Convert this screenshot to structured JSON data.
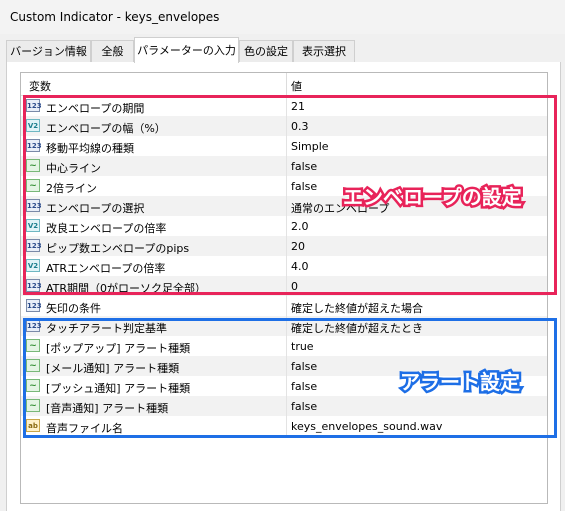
{
  "window": {
    "title": "Custom Indicator - keys_envelopes"
  },
  "tabs": [
    "バージョン情報",
    "全般",
    "パラメーターの入力",
    "色の設定",
    "表示選択"
  ],
  "grid": {
    "col_variable": "変数",
    "col_value": "値",
    "rows": [
      {
        "icon": "123",
        "label": "エンベロープの期間",
        "value": "21"
      },
      {
        "icon": "V2",
        "label": "エンベロープの幅（%）",
        "value": "0.3"
      },
      {
        "icon": "123",
        "label": "移動平均線の種類",
        "value": "Simple"
      },
      {
        "icon": "~",
        "label": "中心ライン",
        "value": "false"
      },
      {
        "icon": "~",
        "label": "2倍ライン",
        "value": "false"
      },
      {
        "icon": "123",
        "label": "エンベロープの選択",
        "value": "通常のエンベロープ"
      },
      {
        "icon": "V2",
        "label": "改良エンベロープの倍率",
        "value": "2.0"
      },
      {
        "icon": "123",
        "label": "ピップ数エンベロープのpips",
        "value": "20"
      },
      {
        "icon": "V2",
        "label": "ATRエンベロープの倍率",
        "value": "4.0"
      },
      {
        "icon": "123",
        "label": "ATR期間（0がローソク足全部）",
        "value": "0"
      },
      {
        "icon": "123",
        "label": "矢印の条件",
        "value": "確定した終値が超えた場合"
      },
      {
        "icon": "123",
        "label": "タッチアラート判定基準",
        "value": "確定した終値が超えたとき"
      },
      {
        "icon": "~",
        "label": "[ポップアップ] アラート種類",
        "value": "true"
      },
      {
        "icon": "~",
        "label": "[メール通知] アラート種類",
        "value": "false"
      },
      {
        "icon": "~",
        "label": "[プッシュ通知] アラート種類",
        "value": "false"
      },
      {
        "icon": "~",
        "label": "[音声通知] アラート種類",
        "value": "false"
      },
      {
        "icon": "ab",
        "label": "音声ファイル名",
        "value": "keys_envelopes_sound.wav"
      }
    ]
  },
  "annotations": {
    "envelope_settings": "エンベロープの設定",
    "alert_settings": "アラート設定"
  },
  "colors": {
    "red_box": "#e8245a",
    "blue_box": "#1e6fe6"
  }
}
